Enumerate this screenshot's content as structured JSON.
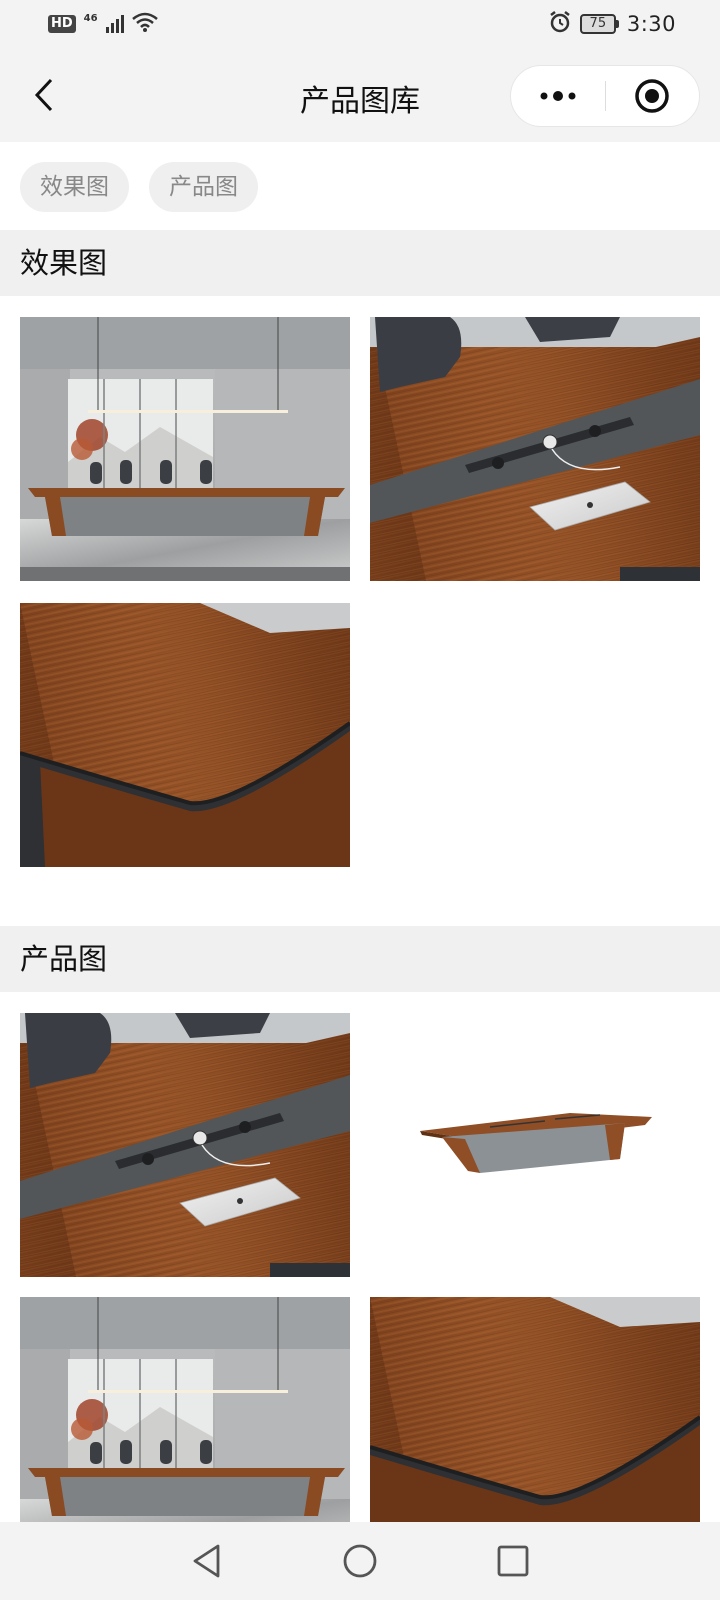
{
  "status_bar": {
    "hd_label": "HD",
    "network_label": "46",
    "battery_level": "75",
    "time": "3:30",
    "icons": [
      "hd-icon",
      "signal-icon",
      "wifi-icon",
      "alarm-icon",
      "battery-icon"
    ]
  },
  "nav": {
    "title": "产品图库",
    "icons": [
      "back-arrow-icon",
      "more-dots-icon",
      "target-close-icon"
    ]
  },
  "filters": [
    {
      "label": "效果图"
    },
    {
      "label": "产品图"
    }
  ],
  "sections": [
    {
      "title": "效果图",
      "images": [
        "conference-room-scene",
        "table-cable-tray-closeup",
        "table-edge-wood-closeup"
      ]
    },
    {
      "title": "产品图",
      "images": [
        "table-cable-tray-closeup",
        "conference-table-product",
        "conference-room-scene",
        "table-edge-wood-closeup"
      ]
    }
  ],
  "system_nav": {
    "icons": [
      "nav-back-triangle-icon",
      "nav-home-circle-icon",
      "nav-recents-square-icon"
    ]
  },
  "colors": {
    "header_bg": "#f3f3f3",
    "section_header_bg": "#f0f0f0",
    "chip_bg": "#efefef",
    "chip_text": "#888888",
    "wood": "#8a4a22"
  }
}
